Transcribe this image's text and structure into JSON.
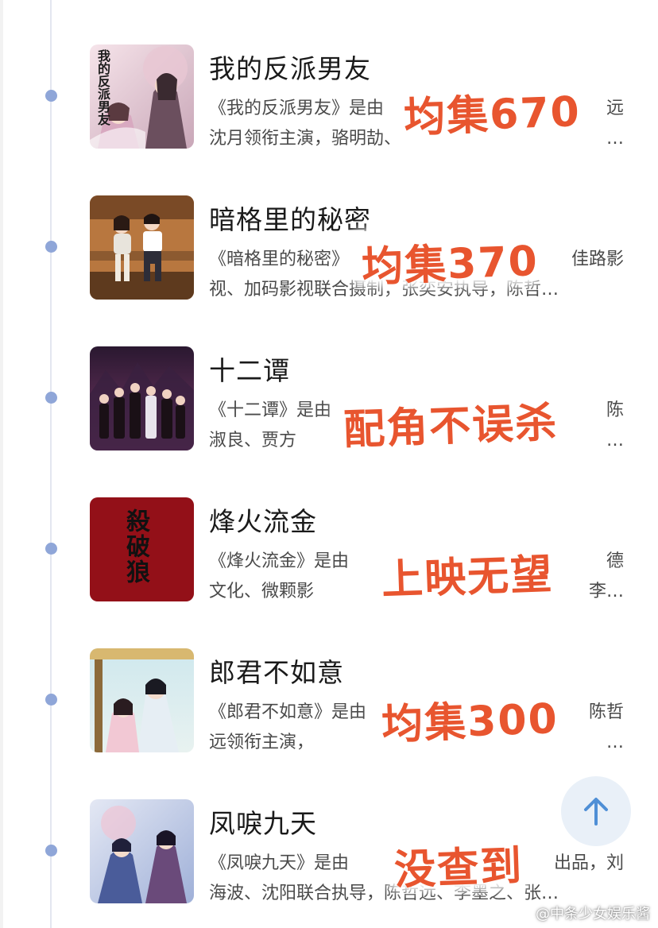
{
  "colors": {
    "timeline_dot": "#8fa6d8",
    "overlay_text": "#e8552f",
    "up_button_bg": "#e9f0f8",
    "up_arrow": "#4f8fd6"
  },
  "items": [
    {
      "title": "我的反派男友",
      "desc_line1": "《我的反派男友》是由",
      "desc_line1_tail": "远",
      "desc_line2": "沈月领衔主演，骆明劼、",
      "desc_line2_tail": "…",
      "overlay": "均集670",
      "poster_icon": "drama-poster-romance",
      "poster_caption": "我的反派男友"
    },
    {
      "title": "暗格里的秘密",
      "desc_line1": "《暗格里的秘密》",
      "desc_line1_tail": "佳路影",
      "desc_line2": "视、加码影视联合摄制，张奕安执导，陈哲…",
      "desc_line2_tail": "",
      "overlay": "均集370",
      "poster_icon": "drama-poster-campus",
      "poster_caption": ""
    },
    {
      "title": "十二谭",
      "desc_line1": "《十二谭》是由",
      "desc_line1_tail": "陈",
      "desc_line2": "淑良、贾方",
      "desc_line2_tail": "…",
      "overlay": "配角不误杀",
      "poster_icon": "drama-poster-ensemble",
      "poster_caption": ""
    },
    {
      "title": "烽火流金",
      "desc_line1": "《烽火流金》是由",
      "desc_line1_tail": "德",
      "desc_line2": "文化、微颗影",
      "desc_line2_tail": "李…",
      "overlay": "上映无望",
      "poster_icon": "drama-poster-calligraphy",
      "poster_caption": "殺破狼"
    },
    {
      "title": "郎君不如意",
      "desc_line1": "《郎君不如意》是由",
      "desc_line1_tail": "陈哲",
      "desc_line2": "远领衔主演，",
      "desc_line2_tail": "…",
      "overlay": "均集300",
      "poster_icon": "drama-poster-costume",
      "poster_caption": ""
    },
    {
      "title": "凤唳九天",
      "desc_line1": "《凤唳九天》是由",
      "desc_line1_tail": "出品，刘",
      "desc_line2": "海波、沈阳联合执导，陈哲远、李墨之、张…",
      "desc_line2_tail": "",
      "overlay": "没查到",
      "poster_icon": "drama-poster-fantasy",
      "poster_caption": ""
    }
  ],
  "scroll_top_icon": "arrow-up-icon",
  "watermark": "@中条少女娱乐酱"
}
